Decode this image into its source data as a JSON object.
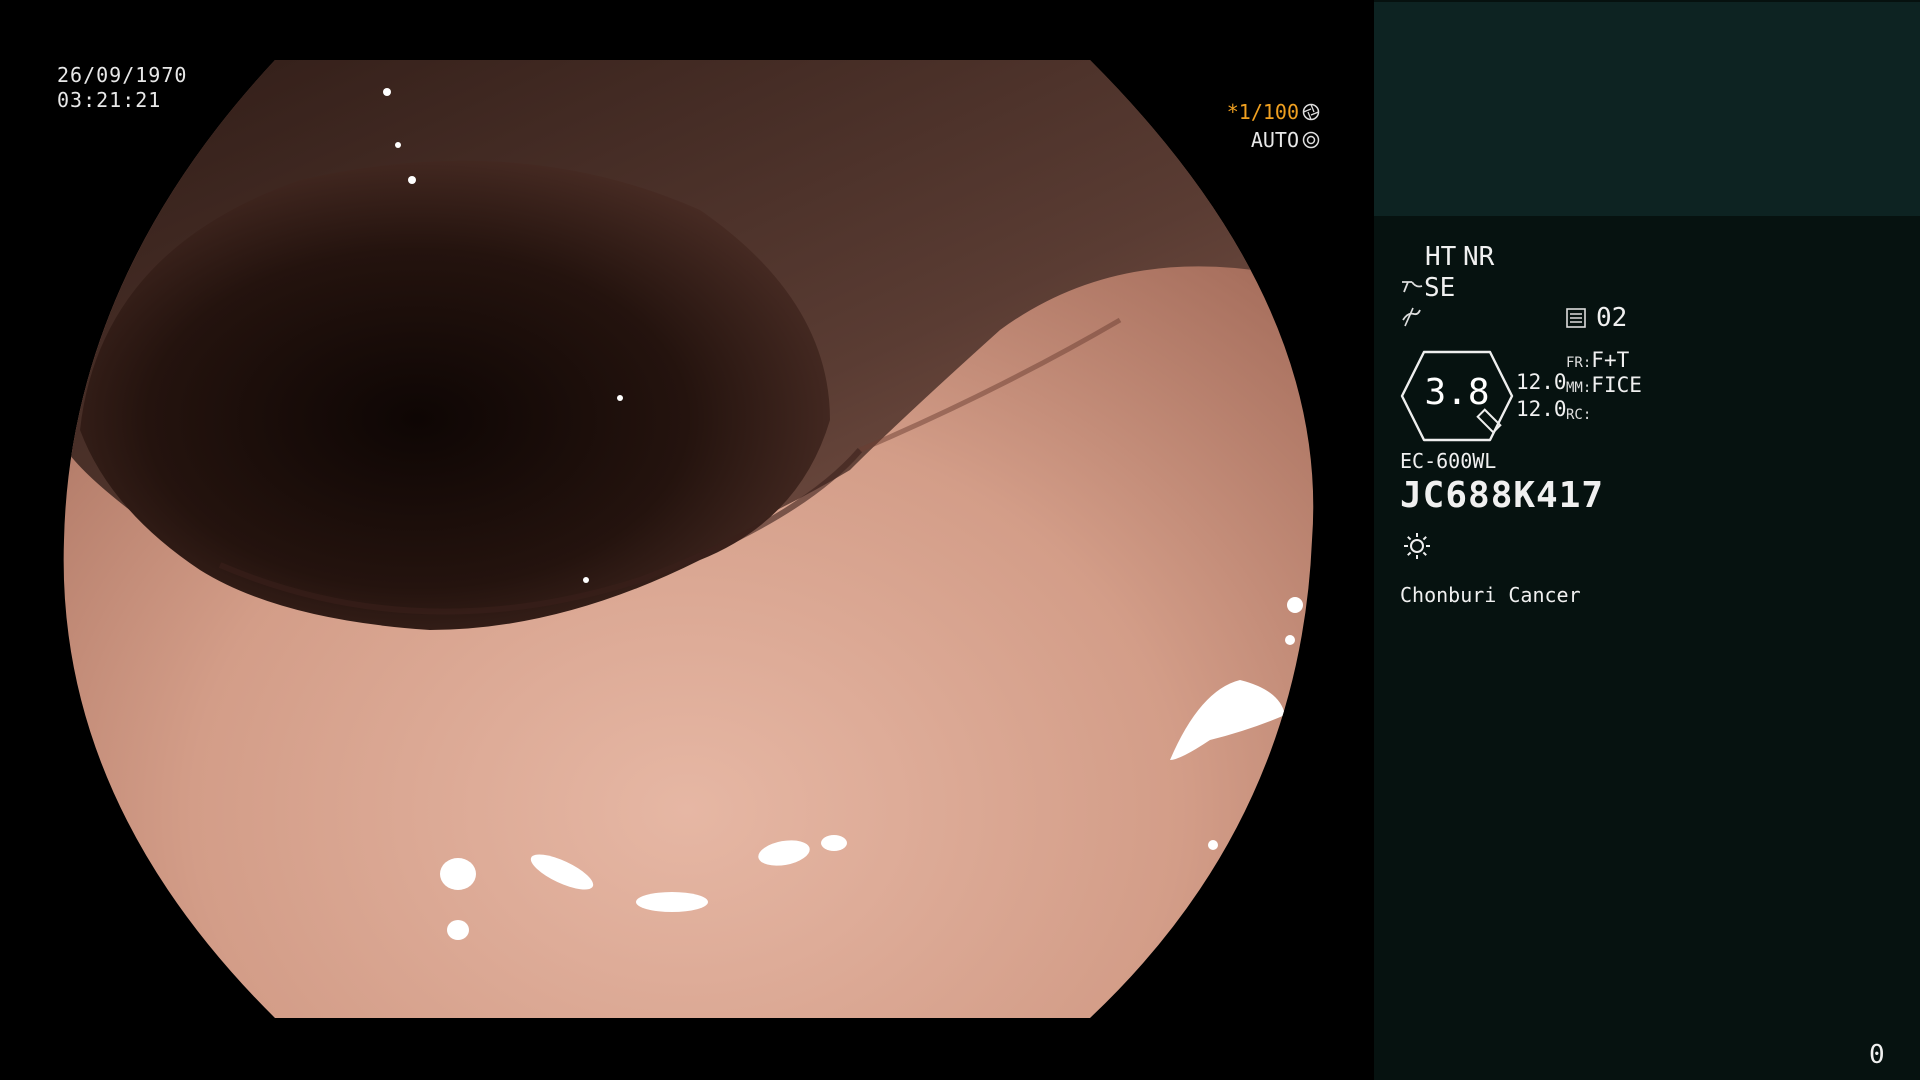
{
  "exam": {
    "date": "26/09/1970",
    "time": "03:21:21"
  },
  "exposure": {
    "shutter": "*1/100",
    "mode": "AUTO",
    "shutter_icon": "aperture-icon",
    "mode_icon": "iris-icon"
  },
  "panel": {
    "ht": "HT",
    "nr": "NR",
    "se": "SE",
    "memory": "02",
    "zoom": "3.8",
    "level1": "12.0",
    "level2": "12.0",
    "fr_label": "FR:",
    "fr_value": "F+T",
    "mm_label": "MM:",
    "mm_value": "FICE",
    "rc_label": "RC:",
    "rc_value": "",
    "scope_model": "EC-600WL",
    "serial": "JC688K417",
    "institution": "Chonburi Cancer",
    "counter": "0"
  },
  "colors": {
    "accent": "#f0a020",
    "panel_top": "#0d2322",
    "panel_bottom": "#061210"
  }
}
